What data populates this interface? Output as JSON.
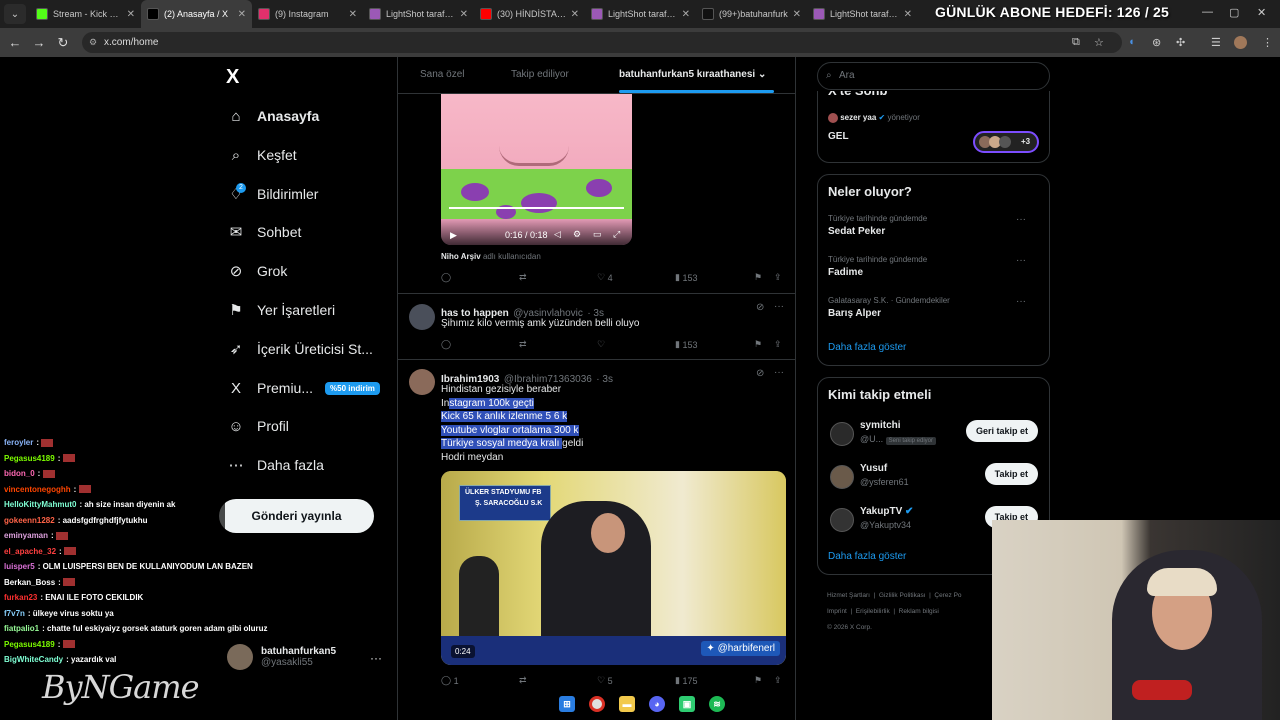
{
  "browser": {
    "tabs": [
      {
        "title": "Stream - Kick Dash",
        "favicon": "kick-icon",
        "color": "#53fc18",
        "active": false
      },
      {
        "title": "(2) Anasayfa / X",
        "favicon": "x-icon",
        "color": "#000000",
        "active": true
      },
      {
        "title": "(9) Instagram",
        "favicon": "instagram-icon",
        "color": "#e1306c",
        "active": false
      },
      {
        "title": "LightShot tarafından",
        "favicon": "lightshot-icon",
        "color": "#9b59b6",
        "active": false
      },
      {
        "title": "(30) HİNDİSTAN İL",
        "favicon": "youtube-icon",
        "color": "#ff0000",
        "active": false
      },
      {
        "title": "LightShot tarafından",
        "favicon": "lightshot-icon",
        "color": "#9b59b6",
        "active": false
      },
      {
        "title": "(99+)batuhanfurk",
        "favicon": "tiktok-icon",
        "color": "#111111",
        "active": false
      },
      {
        "title": "LightShot tarafından",
        "favicon": "lightshot-icon",
        "color": "#9b59b6",
        "active": false
      }
    ],
    "url": "x.com/home"
  },
  "stream_overlay": {
    "goal": "GÜNLÜK ABONE HEDEFİ: 126 / 25",
    "brand": "ByNGame"
  },
  "sidebar": {
    "logo": "X",
    "items": [
      {
        "label": "Anasayfa",
        "icon": "home-icon",
        "glyph": "⌂"
      },
      {
        "label": "Keşfet",
        "icon": "search-icon",
        "glyph": "⌕"
      },
      {
        "label": "Bildirimler",
        "icon": "bell-icon",
        "glyph": "♢"
      },
      {
        "label": "Sohbet",
        "icon": "mail-icon",
        "glyph": "✉"
      },
      {
        "label": "Grok",
        "icon": "grok-icon",
        "glyph": "⊘"
      },
      {
        "label": "Yer İşaretleri",
        "icon": "bookmark-icon",
        "glyph": "⚑"
      },
      {
        "label": "İçerik Üreticisi St...",
        "icon": "rocket-icon",
        "glyph": "➶"
      },
      {
        "label": "Premiu...",
        "icon": "x-premium-icon",
        "glyph": "X"
      },
      {
        "label": "Profil",
        "icon": "profile-icon",
        "glyph": "☺"
      },
      {
        "label": "Daha fazla",
        "icon": "more-circle-icon",
        "glyph": "⋯"
      }
    ],
    "notif_count": "2",
    "premium_badge": "%50 indirim",
    "post_button": "Gönderi yayınla",
    "account": {
      "name": "batuhanfurkan5",
      "handle": "@yasakli55"
    }
  },
  "feed": {
    "tabs": [
      "Sana özel",
      "Takip ediliyor",
      "batuhanfurkan5 kıraathanesi"
    ],
    "video1": {
      "time": "0:16 / 0:18",
      "source_name": "Niho Arşiv",
      "source_suffix": "adlı kullanıcıdan",
      "likes": "4",
      "views": "153"
    },
    "tweet2": {
      "name": "has to happen",
      "handle": "@yasinvlahovic",
      "time": "· 3s",
      "text": "Şihımız kilo vermiş amk yüzünden belli oluyo",
      "views": "153"
    },
    "tweet3": {
      "name": "Ibrahim1903",
      "handle": "@Ibrahim71363036",
      "time": "· 3s",
      "lines": [
        "Hindistan gezisiyle beraber",
        "Instagram 100k geçti",
        "Kick 65 k anlık izlenme 5 6 k",
        "Youtube vloglar ortalama 300 k",
        "Türkiye sosyal medya kralı geldi",
        "Hodri meydan"
      ],
      "video_banner1": "ÜLKER STADYUMU FB",
      "video_banner2": "Ş. SARACOĞLU S.K",
      "video_duration": "0:24",
      "video_watermark": "@harbifenerl",
      "replies": "1",
      "likes": "5",
      "views": "175"
    }
  },
  "right": {
    "search_placeholder": "Ara",
    "community": {
      "title_partial": "X'te Sohb",
      "user": "sezer yaa",
      "role": "yönetiyor",
      "post": "GEL",
      "more": "+3"
    },
    "trends": {
      "title": "Neler oluyor?",
      "items": [
        {
          "meta": "Türkiye tarihinde gündemde",
          "name": "Sedat Peker"
        },
        {
          "meta": "Türkiye tarihinde gündemde",
          "name": "Fadime"
        },
        {
          "meta": "Galatasaray S.K. · Gündemdekiler",
          "name": "Barış Alper"
        }
      ],
      "show_more": "Daha fazla göster"
    },
    "who_to_follow": {
      "title": "Kimi takip etmeli",
      "users": [
        {
          "name": "symitchi",
          "handle": "@U...",
          "tag": "Seni takip ediyor",
          "button": "Geri takip et"
        },
        {
          "name": "Yusuf",
          "handle": "@ysferen61",
          "tag": "",
          "button": "Takip et"
        },
        {
          "name": "YakupTV",
          "handle": "@Yakuptv34",
          "tag": "",
          "button": "Takip et"
        }
      ],
      "show_more": "Daha fazla göster"
    },
    "footer": [
      "Hizmet Şartları",
      "Gizlilik Politikası",
      "Çerez Po",
      "Imprint",
      "Erişilebilirlik",
      "Reklam bilgisi",
      "© 2026 X Corp."
    ]
  },
  "chat": [
    {
      "user": "feroyler",
      "msg": "",
      "color": "#8ab4f8"
    },
    {
      "user": "Pegasus4189",
      "msg": "",
      "color": "#7cfc00"
    },
    {
      "user": "bidon_0",
      "msg": "",
      "color": "#ff69b4"
    },
    {
      "user": "vincentonegoghh",
      "msg": "",
      "color": "#ff4500"
    },
    {
      "user": "HelloKittyMahmut0",
      "msg": "ah size insan diyenin ak",
      "color": "#7fffd4"
    },
    {
      "user": "gokeenn1282",
      "msg": "aadsfgdfrghdfjfytukhu",
      "color": "#ff6347"
    },
    {
      "user": "eminyaman",
      "msg": "",
      "color": "#dda0dd"
    },
    {
      "user": "el_apache_32",
      "msg": "",
      "color": "#ff4040"
    },
    {
      "user": "luisper5",
      "msg": "OLM LUISPERSI BEN DE KULLANIYODUM LAN BAZEN",
      "color": "#da70d6"
    },
    {
      "user": "Berkan_Boss",
      "msg": "",
      "color": "#ffffff"
    },
    {
      "user": "furkan23",
      "msg": "ENAI ILE FOTO CEKILDIK",
      "color": "#ff3030"
    },
    {
      "user": "f7v7n",
      "msg": "ülkeye virus soktu ya",
      "color": "#87cefa"
    },
    {
      "user": "fiatpalio1",
      "msg": "chatte ful eskiyaiyz gorsek ataturk goren adam gibi oluruz",
      "color": "#98fb98"
    },
    {
      "user": "Pegasus4189",
      "msg": "",
      "color": "#7cfc00"
    },
    {
      "user": "BigWhiteCandy",
      "msg": "yazardık val",
      "color": "#7fffd4"
    }
  ]
}
